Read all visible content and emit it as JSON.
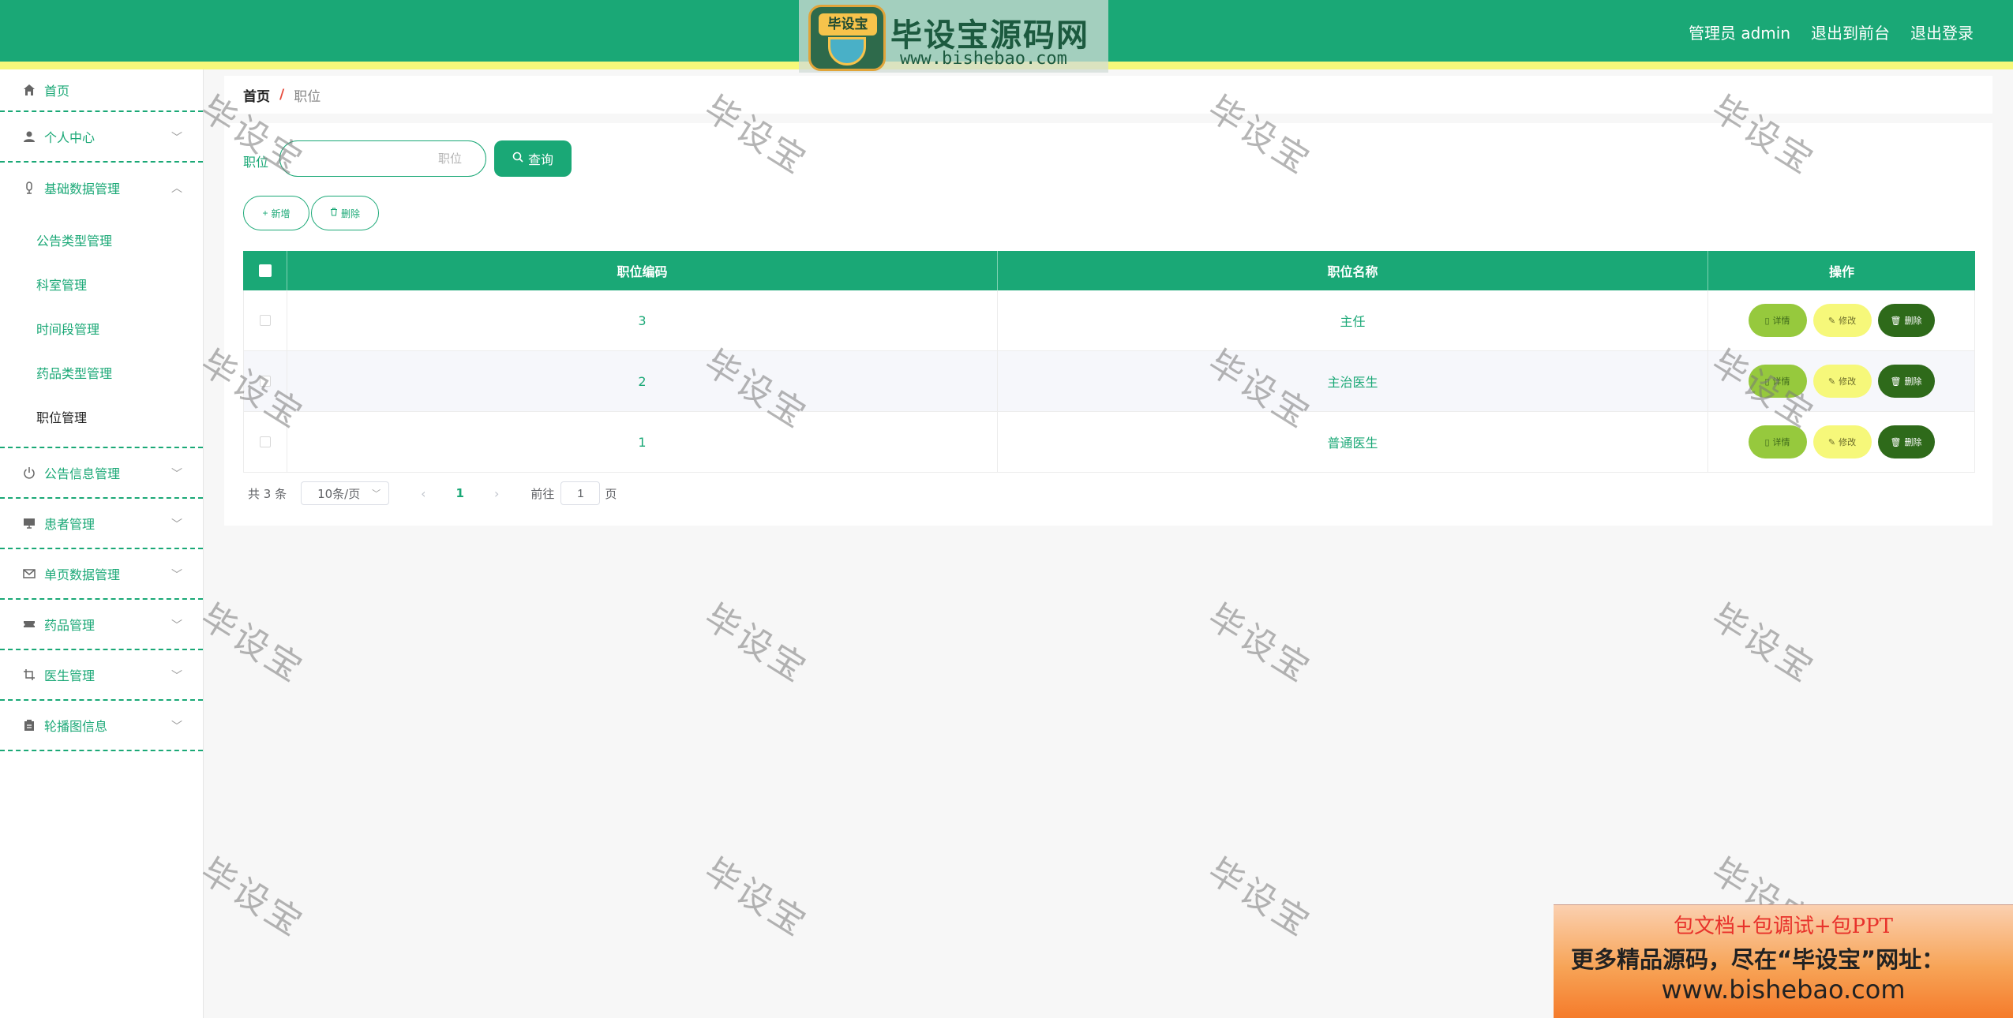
{
  "header": {
    "logo_badge": "毕设宝",
    "logo_title": "毕设宝源码网",
    "logo_url": "www.bishebao.com",
    "user_label": "管理员 admin",
    "to_front": "退出到前台",
    "logout": "退出登录"
  },
  "sidebar": {
    "items": [
      {
        "label": "首页",
        "icon": "home-icon"
      },
      {
        "label": "个人中心",
        "icon": "user-icon"
      },
      {
        "label": "基础数据管理",
        "icon": "microphone-icon"
      },
      {
        "label": "公告信息管理",
        "icon": "power-icon"
      },
      {
        "label": "患者管理",
        "icon": "monitor-icon"
      },
      {
        "label": "单页数据管理",
        "icon": "mail-icon"
      },
      {
        "label": "药品管理",
        "icon": "ticket-icon"
      },
      {
        "label": "医生管理",
        "icon": "crop-icon"
      },
      {
        "label": "轮播图信息",
        "icon": "clipboard-icon"
      }
    ],
    "submenu": [
      "公告类型管理",
      "科室管理",
      "时间段管理",
      "药品类型管理",
      "职位管理"
    ]
  },
  "breadcrumb": {
    "home": "首页",
    "sep": "/",
    "current": "职位"
  },
  "search": {
    "label": "职位",
    "placeholder": "职位",
    "button": "查询"
  },
  "actions": {
    "add": "新增",
    "delete": "删除"
  },
  "table": {
    "columns": [
      "职位编码",
      "职位名称",
      "操作"
    ],
    "rows": [
      {
        "code": "3",
        "name": "主任"
      },
      {
        "code": "2",
        "name": "主治医生"
      },
      {
        "code": "1",
        "name": "普通医生"
      }
    ],
    "ops": {
      "detail": "详情",
      "edit": "修改",
      "delete": "删除"
    }
  },
  "pager": {
    "total": "共 3 条",
    "page_size": "10条/页",
    "current_page": "1",
    "goto": "前往",
    "jump_value": "1",
    "page_word": "页"
  },
  "watermark": "毕设宝",
  "ad": {
    "line1": "包文档+包调试+包PPT",
    "line2": "更多精品源码，尽在“毕设宝”网址：",
    "line3": "www.bishebao.com"
  },
  "colors": {
    "primary": "#1aa876",
    "strip": "#f6f87a",
    "detail": "#96c93d",
    "edit": "#f6f87a",
    "delete": "#2e6a1a"
  }
}
